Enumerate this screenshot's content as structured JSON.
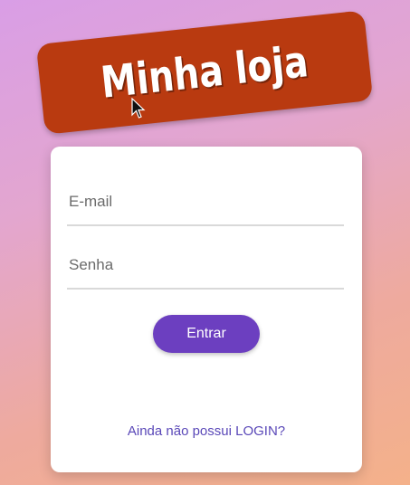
{
  "brand": {
    "title": "Minha loja"
  },
  "form": {
    "email_placeholder": "E-mail",
    "password_placeholder": "Senha",
    "submit_label": "Entrar",
    "register_link": "Ainda não possui LOGIN?"
  },
  "colors": {
    "brand_bg": "#b93a10",
    "button_bg": "#6c3fc0",
    "link": "#5a48b8"
  }
}
